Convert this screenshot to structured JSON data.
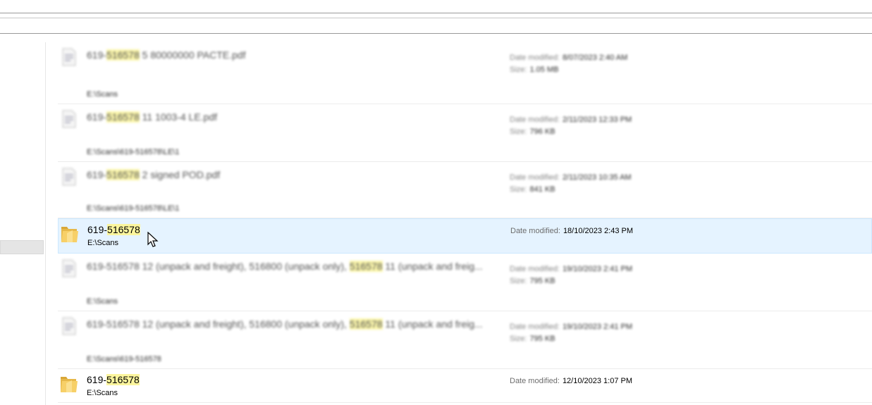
{
  "window": {
    "nav_pane": {}
  },
  "results": [
    {
      "kind": "file",
      "blurred": true,
      "name_prefix": "619-",
      "name_match": "516578",
      "name_suffix": " 5 80000000 PACTE.pdf",
      "path": "E:\\Scans",
      "modified_label": "Date modified:",
      "modified_value": "8/07/2023 2:40 AM",
      "size_label": "Size:",
      "size_value": "1.05 MB"
    },
    {
      "kind": "file",
      "blurred": true,
      "name_prefix": "619-",
      "name_match": "516578",
      "name_suffix": " 11 1003-4 LE.pdf",
      "path": "E:\\Scans\\619-516578\\LE\\1",
      "modified_label": "Date modified:",
      "modified_value": "2/11/2023 12:33 PM",
      "size_label": "Size:",
      "size_value": "796 KB"
    },
    {
      "kind": "file",
      "blurred": true,
      "name_prefix": "619-",
      "name_match": "516578",
      "name_suffix": " 2 signed POD.pdf",
      "path": "E:\\Scans\\619-516578\\LE\\1",
      "modified_label": "Date modified:",
      "modified_value": "2/11/2023 10:35 AM",
      "size_label": "Size:",
      "size_value": "841 KB"
    },
    {
      "kind": "folder",
      "blurred": false,
      "selected": true,
      "name_prefix": "619-",
      "name_match": "516578",
      "name_suffix": "",
      "path": "E:\\Scans",
      "modified_label": "Date modified:",
      "modified_value": "18/10/2023 2:43 PM"
    },
    {
      "kind": "file",
      "blurred": true,
      "name_prefix": "619-516578 12 (unpack and freight), 516800 (unpack only), ",
      "name_match": "516578",
      "name_suffix": " 11 (unpack and freig...",
      "path": "E:\\Scans",
      "modified_label": "Date modified:",
      "modified_value": "19/10/2023 2:41 PM",
      "size_label": "Size:",
      "size_value": "795 KB"
    },
    {
      "kind": "file",
      "blurred": true,
      "name_prefix": "619-516578 12 (unpack and freight), 516800 (unpack only), ",
      "name_match": "516578",
      "name_suffix": " 11 (unpack and freig...",
      "path": "E:\\Scans\\619-516578",
      "modified_label": "Date modified:",
      "modified_value": "19/10/2023 2:41 PM",
      "size_label": "Size:",
      "size_value": "795 KB"
    },
    {
      "kind": "folder",
      "blurred": false,
      "name_prefix": "619-",
      "name_match": "516578",
      "name_suffix": "",
      "path": "E:\\Scans",
      "modified_label": "Date modified:",
      "modified_value": "12/10/2023 1:07 PM"
    }
  ]
}
